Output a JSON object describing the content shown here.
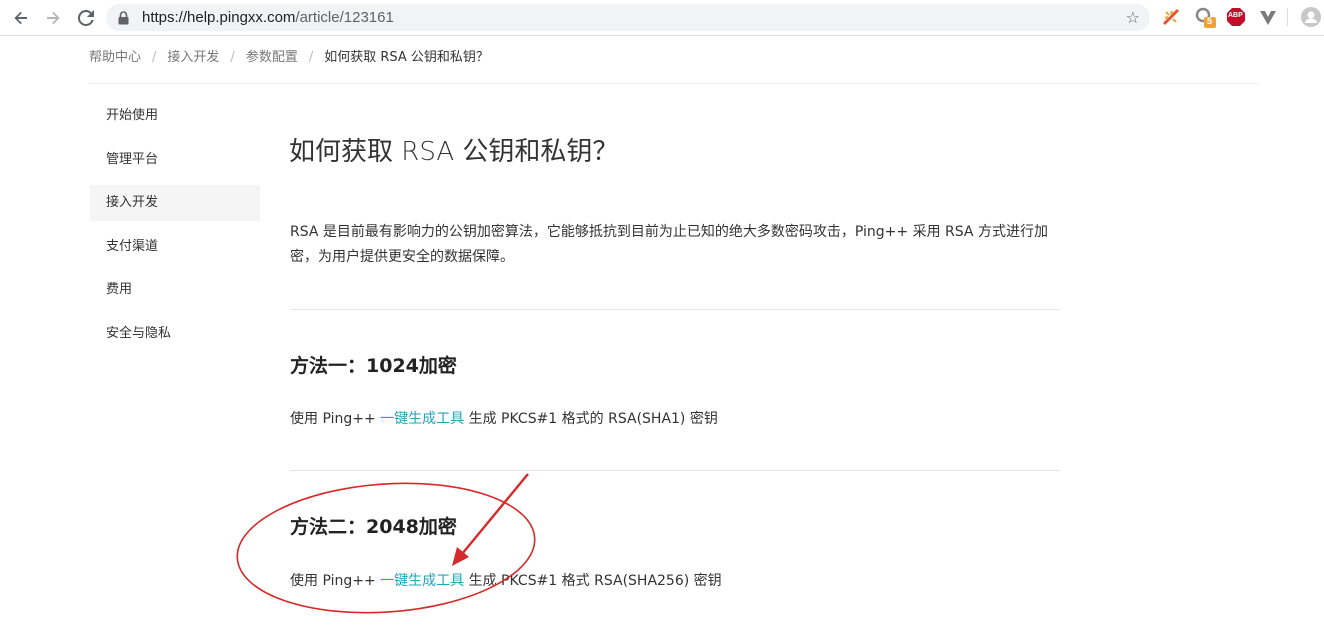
{
  "browser": {
    "url_host": "https://help.pingxx.com",
    "url_path": "/article/123161",
    "ext_badge": "5",
    "ext_abp": "ABP"
  },
  "breadcrumb": {
    "items": [
      "帮助中心",
      "接入开发",
      "参数配置"
    ],
    "current": "如何获取 RSA 公钥和私钥？",
    "separator": "/"
  },
  "sidebar": {
    "items": [
      {
        "label": "开始使用"
      },
      {
        "label": "管理平台"
      },
      {
        "label": "接入开发",
        "active": true
      },
      {
        "label": "支付渠道"
      },
      {
        "label": "费用"
      },
      {
        "label": "安全与隐私"
      }
    ]
  },
  "article": {
    "title": "如何获取 RSA 公钥和私钥？",
    "intro": "RSA 是目前最有影响力的公钥加密算法，它能够抵抗到目前为止已知的绝大多数密码攻击，Ping++ 采用 RSA 方式进行加密，为用户提供更安全的数据保障。",
    "method1": {
      "heading": "方法一：1024加密",
      "prefix": "使用 Ping++ ",
      "link": "一键生成工具",
      "suffix": " 生成 PKCS#1 格式的 RSA(SHA1) 密钥"
    },
    "method2": {
      "heading": "方法二：2048加密",
      "prefix": "使用 Ping++ ",
      "link": "一键生成工具",
      "suffix": " 生成 PKCS#1 格式 RSA(SHA256) 密钥"
    }
  },
  "colors": {
    "link": "#22a6b8",
    "annotation": "#d62a2a"
  }
}
